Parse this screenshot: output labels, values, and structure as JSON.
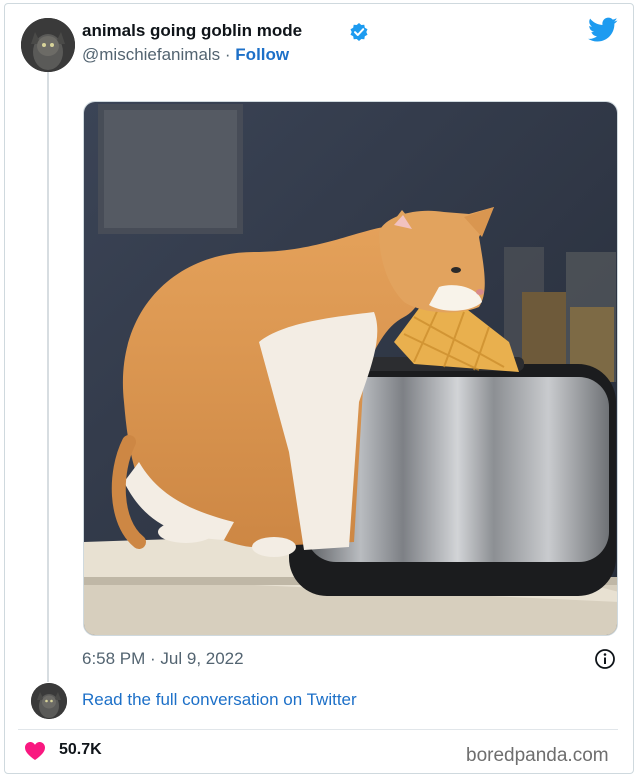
{
  "tweet": {
    "display_name": "animals going goblin mode",
    "handle": "@mischiefanimals",
    "separator": " · ",
    "follow_label": "Follow",
    "timestamp": "6:58 PM · Jul 9, 2022",
    "read_more_label": "Read the full conversation on Twitter",
    "likes": "50.7K"
  },
  "watermark": "boredpanda.com",
  "icons": {
    "verified": "verified-badge-icon",
    "brand": "twitter-bird-icon",
    "info": "info-icon",
    "like": "heart-icon"
  },
  "colors": {
    "link_blue": "#1d70c8",
    "twitter_blue": "#1d9bf0",
    "heart_red": "#f91880",
    "secondary_text": "#536471"
  }
}
